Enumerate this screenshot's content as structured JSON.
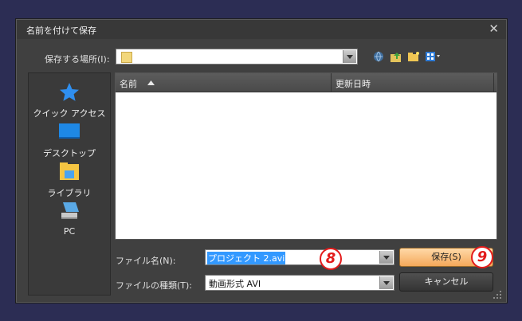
{
  "window": {
    "title": "名前を付けて保存"
  },
  "location": {
    "label": "保存する場所(I):",
    "value": ""
  },
  "toolbar": {
    "icons": [
      "globe-back-icon",
      "up-folder-icon",
      "new-folder-icon",
      "view-menu-icon"
    ]
  },
  "sidebar": {
    "items": [
      {
        "label": "クイック アクセス",
        "icon": "star-icon"
      },
      {
        "label": "デスクトップ",
        "icon": "desktop-icon"
      },
      {
        "label": "ライブラリ",
        "icon": "library-icon"
      },
      {
        "label": "PC",
        "icon": "pc-icon"
      }
    ]
  },
  "list": {
    "columns": [
      "名前",
      "更新日時"
    ],
    "rows": []
  },
  "filename": {
    "label": "ファイル名(N):",
    "value": "プロジェクト 2.avi"
  },
  "filetype": {
    "label": "ファイルの種類(T):",
    "value": "動画形式 AVI"
  },
  "buttons": {
    "save": "保存(S)",
    "cancel": "キャンセル"
  },
  "callouts": {
    "filename": "8",
    "save": "9"
  },
  "colors": {
    "accent": "#f4a85a",
    "callout": "#e31b1b",
    "selection": "#3399ff"
  }
}
